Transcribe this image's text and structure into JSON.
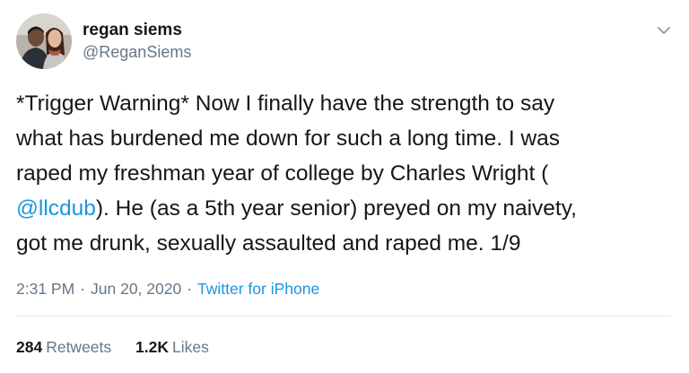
{
  "user": {
    "display_name": "regan siems",
    "handle": "@ReganSiems"
  },
  "tweet": {
    "lines": [
      "*Trigger Warning* Now I finally have the strength to say",
      "what has burdened me down for such a long time. I was",
      "raped my freshman year of college by Charles Wright ("
    ],
    "line4_mention": "@llcdub",
    "line4_rest": "). He (as a 5th year senior) preyed on my naivety,",
    "line5": "got me drunk, sexually assaulted and raped me. 1/9"
  },
  "meta": {
    "time": "2:31 PM",
    "date": "Jun 20, 2020",
    "separator": "·",
    "source": "Twitter for iPhone"
  },
  "stats": {
    "retweets_count": "284",
    "retweets_label": "Retweets",
    "likes_count": "1.2K",
    "likes_label": "Likes"
  },
  "icons": {
    "menu": "chevron-down-icon"
  },
  "colors": {
    "link": "#1b95e0",
    "secondary_text": "#657786",
    "primary_text": "#14171a"
  }
}
